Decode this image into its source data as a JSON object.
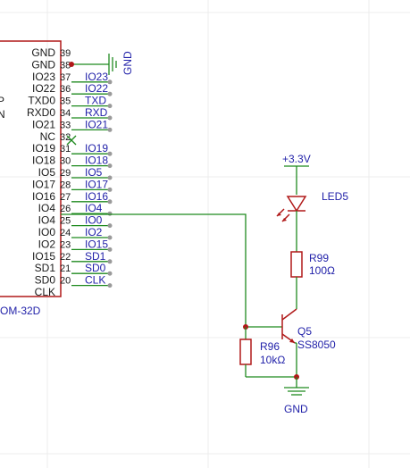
{
  "module": {
    "part_label_partial": "OM-32D",
    "left_fragments": [
      "P",
      "N"
    ],
    "pins": [
      {
        "name": "GND",
        "num": "39",
        "net": ""
      },
      {
        "name": "GND",
        "num": "38",
        "net": ""
      },
      {
        "name": "IO23",
        "num": "37",
        "net": "IO23"
      },
      {
        "name": "IO22",
        "num": "36",
        "net": "IO22"
      },
      {
        "name": "TXD0",
        "num": "35",
        "net": "TXD"
      },
      {
        "name": "RXD0",
        "num": "34",
        "net": "RXD"
      },
      {
        "name": "IO21",
        "num": "33",
        "net": "IO21"
      },
      {
        "name": "NC",
        "num": "32",
        "net": ""
      },
      {
        "name": "IO19",
        "num": "31",
        "net": "IO19"
      },
      {
        "name": "IO18",
        "num": "30",
        "net": "IO18"
      },
      {
        "name": "IO5",
        "num": "29",
        "net": "IO5"
      },
      {
        "name": "IO17",
        "num": "28",
        "net": "IO17"
      },
      {
        "name": "IO16",
        "num": "27",
        "net": "IO16"
      },
      {
        "name": "IO4",
        "num": "26",
        "net": "IO4"
      },
      {
        "name": "IO4",
        "num": "25",
        "net": "IO0"
      },
      {
        "name": "IO0",
        "num": "24",
        "net": "IO2"
      },
      {
        "name": "IO2",
        "num": "23",
        "net": "IO15"
      },
      {
        "name": "IO15",
        "num": "22",
        "net": "SD1"
      },
      {
        "name": "SD1",
        "num": "21",
        "net": "SD0"
      },
      {
        "name": "SD0",
        "num": "20",
        "net": "CLK"
      },
      {
        "name": "CLK",
        "num": "",
        "net": ""
      }
    ]
  },
  "gnd_top": "GND",
  "power": {
    "label": "+3.3V"
  },
  "led": {
    "designator": "LED5"
  },
  "r99": {
    "designator": "R99",
    "value": "100Ω"
  },
  "q5": {
    "designator": "Q5",
    "value": "SS8050"
  },
  "r96": {
    "designator": "R96",
    "value": "10kΩ"
  },
  "gnd_bottom": "GND"
}
